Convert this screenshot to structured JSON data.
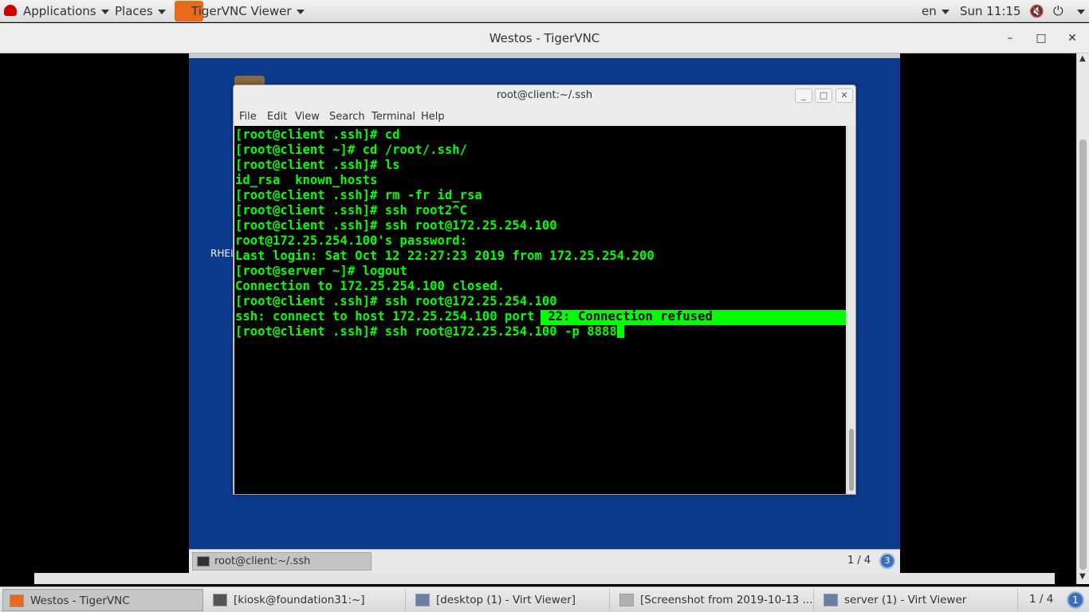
{
  "top_panel": {
    "applications": "Applications",
    "places": "Places",
    "app": "TigerVNC Viewer",
    "lang": "en",
    "clock": "Sun 11:15",
    "volume_icon": "🔇",
    "power_icon": "⏻"
  },
  "window": {
    "title": "Westos - TigerVNC",
    "minimize": "–",
    "maximize": "□",
    "close": "✕"
  },
  "guest": {
    "rhel_label": "RHEL",
    "terminal": {
      "title": "root@client:~/.ssh",
      "menu": [
        "File",
        "Edit",
        "View",
        "Search",
        "Terminal",
        "Help"
      ],
      "lines": [
        "[root@client .ssh]# cd",
        "[root@client ~]# cd /root/.ssh/",
        "[root@client .ssh]# ls",
        "id_rsa  known_hosts",
        "[root@client .ssh]# rm -fr id_rsa",
        "[root@client .ssh]# ssh root2^C",
        "[root@client .ssh]# ssh root@172.25.254.100",
        "root@172.25.254.100's password: ",
        "Last login: Sat Oct 12 22:27:23 2019 from 172.25.254.200",
        "[root@server ~]# logout",
        "Connection to 172.25.254.100 closed.",
        "[root@client .ssh]# ssh root@172.25.254.100",
        "ssh: connect to host 172.25.254.100 port",
        "[root@client .ssh]# ssh root@172.25.254.100 -p 8888"
      ],
      "highlight_text": " 22: Connection refused"
    },
    "taskbar": {
      "task": "root@client:~/.ssh",
      "pager": "1 / 4",
      "pager_num": "3"
    }
  },
  "bottom_bar": {
    "tasks": [
      "Westos - TigerVNC",
      "[kiosk@foundation31:~]",
      "[desktop (1) - Virt Viewer]",
      "[Screenshot from 2019-10-13 ...",
      "server (1) - Virt Viewer"
    ],
    "pager": "1 / 4",
    "pager_num": "1"
  },
  "colors": {
    "terminal_text": "#00ff00",
    "guest_background": "#0c3b8e"
  }
}
